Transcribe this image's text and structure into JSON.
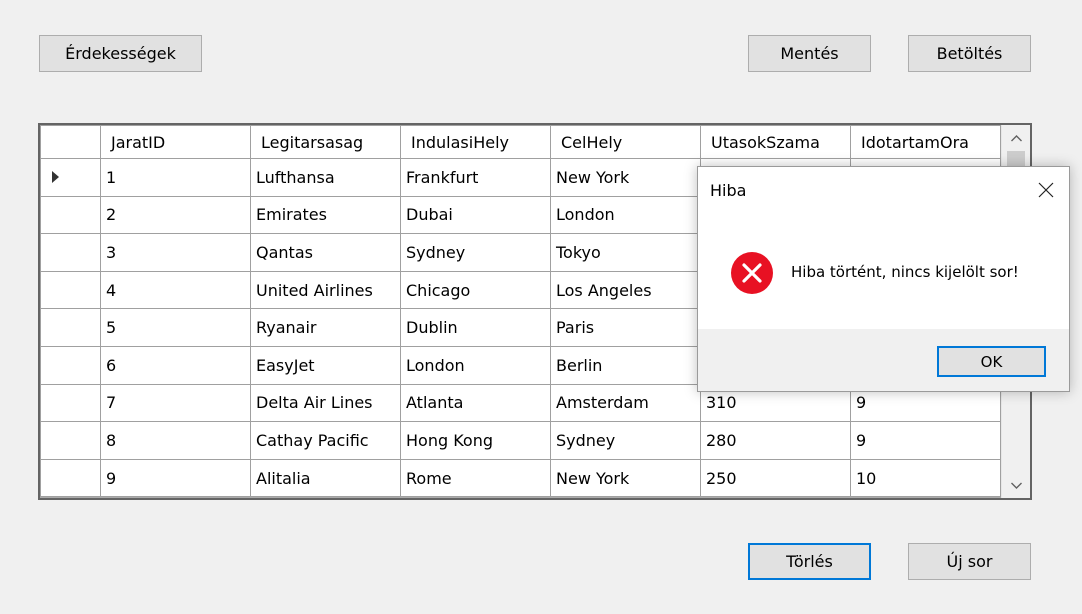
{
  "toolbar": {
    "features_label": "Érdekességek",
    "save_label": "Mentés",
    "load_label": "Betöltés"
  },
  "grid": {
    "columns": [
      "JaratID",
      "Legitarsasag",
      "IndulasiHely",
      "CelHely",
      "UtasokSzama",
      "IdotartamOra"
    ],
    "rows": [
      [
        "1",
        "Lufthansa",
        "Frankfurt",
        "New York",
        "",
        ""
      ],
      [
        "2",
        "Emirates",
        "Dubai",
        "London",
        "",
        ""
      ],
      [
        "3",
        "Qantas",
        "Sydney",
        "Tokyo",
        "",
        ""
      ],
      [
        "4",
        "United Airlines",
        "Chicago",
        "Los Angeles",
        "",
        ""
      ],
      [
        "5",
        "Ryanair",
        "Dublin",
        "Paris",
        "",
        ""
      ],
      [
        "6",
        "EasyJet",
        "London",
        "Berlin",
        "",
        ""
      ],
      [
        "7",
        "Delta Air Lines",
        "Atlanta",
        "Amsterdam",
        "310",
        "9"
      ],
      [
        "8",
        "Cathay Pacific",
        "Hong Kong",
        "Sydney",
        "280",
        "9"
      ],
      [
        "9",
        "Alitalia",
        "Rome",
        "New York",
        "250",
        "10"
      ]
    ],
    "current_row_index": 0
  },
  "bottom": {
    "delete_label": "Törlés",
    "new_row_label": "Új sor"
  },
  "dialog": {
    "title": "Hiba",
    "message": "Hiba történt, nincs kijelölt sor!",
    "ok_label": "OK",
    "error_icon_color": "#e81123"
  },
  "icons": {
    "close": "close-icon",
    "error": "error-icon",
    "scroll_up": "chevron-up-icon",
    "scroll_down": "chevron-down-icon",
    "current_row": "current-row-arrow-icon"
  }
}
